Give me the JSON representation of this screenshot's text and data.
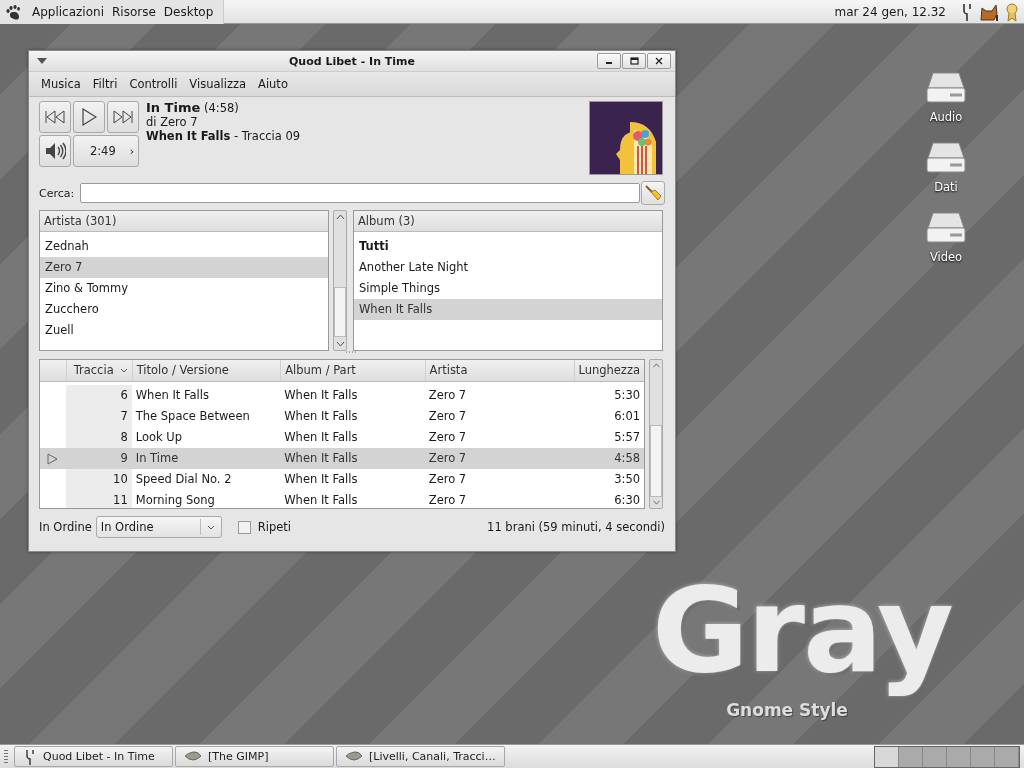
{
  "top_panel": {
    "menus": [
      "Applicazioni",
      "Risorse",
      "Desktop"
    ],
    "clock": "mar 24 gen, 12.32"
  },
  "window": {
    "title": "Quod Libet - In Time",
    "menu": [
      "Musica",
      "Filtri",
      "Controlli",
      "Visualizza",
      "Aiuto"
    ],
    "player": {
      "title": "In Time",
      "duration": "(4:58)",
      "artist": "di Zero 7",
      "album": "When It Falls",
      "track": "- Traccia 09",
      "position": "2:49",
      "time_arrow": "›"
    },
    "search": {
      "label": "Cerca:"
    },
    "artists": {
      "header": "Artista (301)",
      "items": [
        {
          "name": "Zednah",
          "selected": false
        },
        {
          "name": "Zero 7",
          "selected": true
        },
        {
          "name": "Zino & Tommy",
          "selected": false
        },
        {
          "name": "Zucchero",
          "selected": false
        },
        {
          "name": "Zuell",
          "selected": false
        }
      ]
    },
    "albums": {
      "header": "Album (3)",
      "items": [
        {
          "name": "Tutti",
          "kind": "all",
          "selected": false
        },
        {
          "name": "Another Late Night",
          "kind": "album",
          "selected": false
        },
        {
          "name": "Simple Things",
          "kind": "album",
          "selected": false
        },
        {
          "name": "When It Falls",
          "kind": "album",
          "selected": true
        }
      ]
    },
    "tracks": {
      "columns": [
        {
          "label": "Traccia",
          "sorted": true
        },
        {
          "label": "Titolo / Versione",
          "sorted": false
        },
        {
          "label": "Album / Part",
          "sorted": false
        },
        {
          "label": "Artista",
          "sorted": false
        },
        {
          "label": "Lunghezza",
          "sorted": false
        }
      ],
      "rows": [
        {
          "number": "6",
          "title": "When It Falls",
          "album": "When It Falls",
          "artist": "Zero 7",
          "length": "5:30",
          "playing": false,
          "selected": false
        },
        {
          "number": "7",
          "title": "The Space Between",
          "album": "When It Falls",
          "artist": "Zero 7",
          "length": "6:01",
          "playing": false,
          "selected": false
        },
        {
          "number": "8",
          "title": "Look Up",
          "album": "When It Falls",
          "artist": "Zero 7",
          "length": "5:57",
          "playing": false,
          "selected": false
        },
        {
          "number": "9",
          "title": "In Time",
          "album": "When It Falls",
          "artist": "Zero 7",
          "length": "4:58",
          "playing": true,
          "selected": true
        },
        {
          "number": "10",
          "title": "Speed Dial No. 2",
          "album": "When It Falls",
          "artist": "Zero 7",
          "length": "3:50",
          "playing": false,
          "selected": false
        },
        {
          "number": "11",
          "title": "Morning Song",
          "album": "When It Falls",
          "artist": "Zero 7",
          "length": "6:30",
          "playing": false,
          "selected": false
        }
      ]
    },
    "footer": {
      "order_label": "In Ordine",
      "order_value": "In Ordine",
      "repeat": {
        "label": "Ripeti",
        "checked": false
      },
      "status": "11 brani (59 minuti, 4 secondi)"
    }
  },
  "desktop_icons": [
    {
      "label": "Audio"
    },
    {
      "label": "Dati"
    },
    {
      "label": "Video"
    }
  ],
  "wallpaper": {
    "title": "Gray",
    "subtitle": "Gnome Style"
  },
  "taskbar": {
    "tasks": [
      {
        "label": "Quod Libet - In Time",
        "kind": "tuning-fork",
        "selected": false
      },
      {
        "label": "[The GIMP]",
        "kind": "gimp",
        "selected": false
      },
      {
        "label": "[Livelli, Canali, Tracci…",
        "kind": "gimp",
        "selected": false
      }
    ],
    "workspaces": [
      {
        "selected": true
      },
      {
        "selected": false
      },
      {
        "selected": false
      },
      {
        "selected": false
      },
      {
        "selected": false
      },
      {
        "selected": false
      }
    ]
  }
}
